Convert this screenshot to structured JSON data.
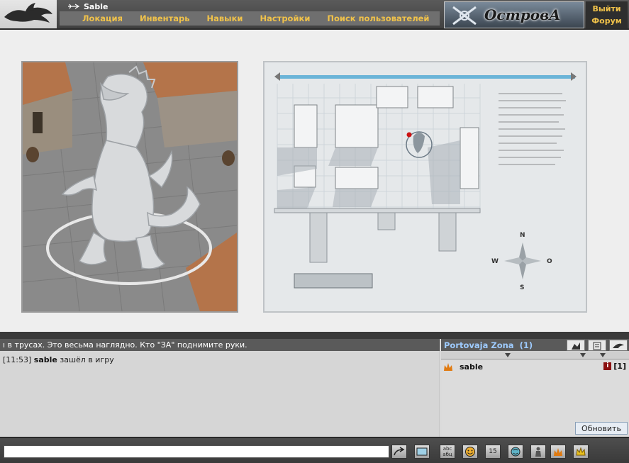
{
  "header": {
    "username": "Sable",
    "menu": [
      "Локация",
      "Инвентарь",
      "Навыки",
      "Настройки",
      "Поиск пользователей"
    ],
    "brand": "ОстровА",
    "links": {
      "logout": "Выйти",
      "forum": "Форум"
    }
  },
  "map": {
    "compass": {
      "n": "N",
      "s": "S",
      "w": "W",
      "e": "O"
    }
  },
  "chat": {
    "banner": "ı в трусах. Это весьма наглядно. Кто \"ЗА\" поднимите руки.",
    "log": [
      {
        "time": "[11:53]",
        "user": "sable",
        "text": "зашёл в игру"
      }
    ]
  },
  "users": {
    "zone": "Portovaja Zona",
    "count": "(1)",
    "list": [
      {
        "name": "sable",
        "info": "i",
        "level": "[1]"
      }
    ],
    "refresh_label": "Обновить"
  },
  "toolbar": {
    "input_value": "",
    "translit_label": "abc абц",
    "timer_label": "15"
  },
  "colors": {
    "menu_text": "#f0c24a",
    "zone_text": "#9ecbff",
    "marker": "#cc1111"
  }
}
